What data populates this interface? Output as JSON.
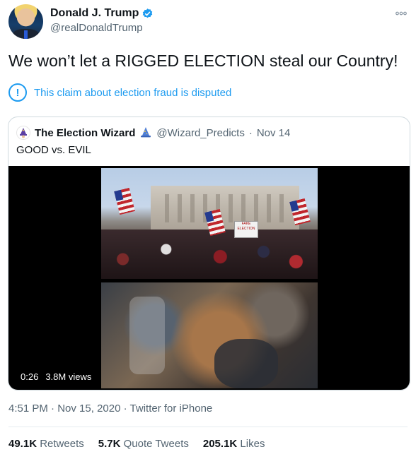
{
  "author": {
    "display_name": "Donald J. Trump",
    "handle": "@realDonaldTrump",
    "verified": true
  },
  "tweet_text": "We won’t let a RIGGED ELECTION steal our Country!",
  "notice": {
    "icon_text": "!",
    "text": "This claim about election fraud is disputed"
  },
  "quoted_tweet": {
    "display_name": "The Election Wizard",
    "handle": "@Wizard_Predicts",
    "separator": "·",
    "date": "Nov 14",
    "text": "GOOD vs. EVIL",
    "video": {
      "duration": "0:26",
      "views": "3.8M views",
      "sign_text": "FAKE ELECTION"
    }
  },
  "meta": {
    "time": "4:51 PM",
    "separator1": "·",
    "date": "Nov 15, 2020",
    "separator2": "·",
    "source": "Twitter for iPhone"
  },
  "stats": [
    {
      "num": "49.1K",
      "label": "Retweets"
    },
    {
      "num": "5.7K",
      "label": "Quote Tweets"
    },
    {
      "num": "205.1K",
      "label": "Likes"
    }
  ],
  "colors": {
    "link_blue": "#1d9bf0",
    "text_primary": "#0f1419",
    "text_secondary": "#536471"
  }
}
